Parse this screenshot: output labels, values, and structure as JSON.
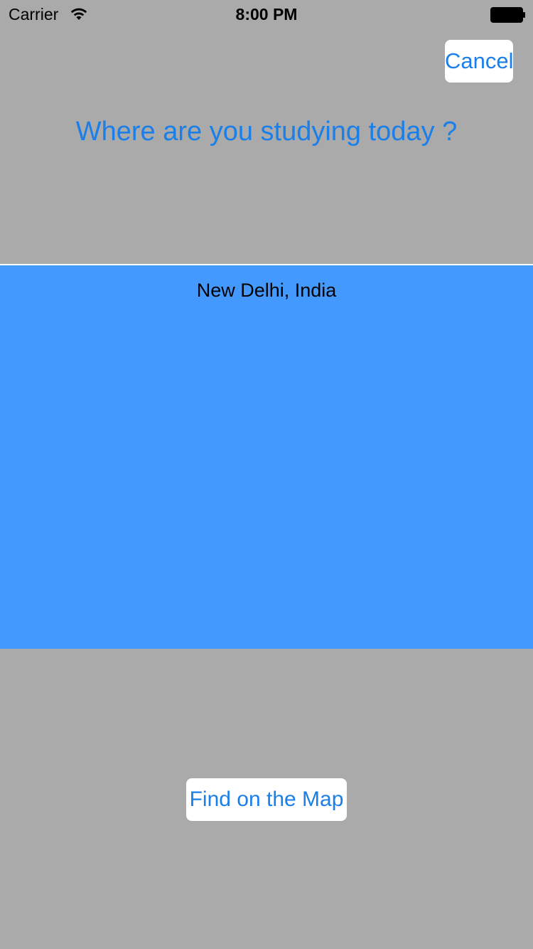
{
  "status_bar": {
    "carrier": "Carrier",
    "time": "8:00 PM",
    "wifi_icon": "wifi-icon",
    "battery_icon": "battery-icon"
  },
  "header": {
    "cancel_label": "Cancel",
    "prompt": "Where are you studying today ?"
  },
  "picker": {
    "selected_location": "New Delhi, India"
  },
  "footer": {
    "find_label": "Find on the Map"
  },
  "colors": {
    "background": "#aaaaaa",
    "picker_background": "#4499ff",
    "accent_text": "#1a7fe8",
    "button_background": "#ffffff"
  }
}
